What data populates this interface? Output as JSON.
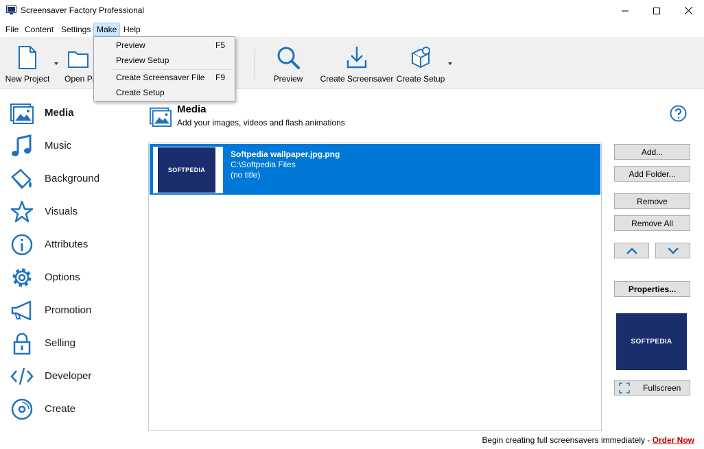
{
  "window": {
    "title": "Screensaver Factory Professional"
  },
  "menubar": {
    "items": [
      "File",
      "Content",
      "Settings",
      "Make",
      "Help"
    ]
  },
  "make_menu": {
    "items": [
      {
        "label": "Preview",
        "shortcut": "F5"
      },
      {
        "label": "Preview Setup",
        "shortcut": ""
      },
      {
        "label": "Create Screensaver File",
        "shortcut": "F9"
      },
      {
        "label": "Create Setup",
        "shortcut": ""
      }
    ]
  },
  "toolbar": {
    "new_project": "New Project",
    "open_project": "Open Pr",
    "preview": "Preview",
    "create_screensaver": "Create Screensaver",
    "create_setup": "Create Setup"
  },
  "sidebar": {
    "items": [
      {
        "label": "Media",
        "icon": "media-icon",
        "active": true
      },
      {
        "label": "Music",
        "icon": "music-icon"
      },
      {
        "label": "Background",
        "icon": "paint-bucket-icon"
      },
      {
        "label": "Visuals",
        "icon": "star-icon"
      },
      {
        "label": "Attributes",
        "icon": "info-icon"
      },
      {
        "label": "Options",
        "icon": "gear-icon"
      },
      {
        "label": "Promotion",
        "icon": "megaphone-icon"
      },
      {
        "label": "Selling",
        "icon": "lock-icon"
      },
      {
        "label": "Developer",
        "icon": "code-icon"
      },
      {
        "label": "Create",
        "icon": "disc-icon"
      }
    ]
  },
  "header": {
    "title": "Media",
    "subtitle": "Add your images, videos and flash animations"
  },
  "media_list": {
    "items": [
      {
        "name": "Softpedia wallpaper.jpg.png",
        "path": "C:\\Softpedia Files",
        "title": "(no title)",
        "thumb_text": "SOFTPEDIA"
      }
    ]
  },
  "buttons": {
    "add": "Add...",
    "add_folder": "Add Folder...",
    "remove": "Remove",
    "remove_all": "Remove All",
    "properties": "Properties...",
    "fullscreen": "Fullscreen"
  },
  "preview": {
    "text": "SOFTPEDIA"
  },
  "footer": {
    "text": "Begin creating full screensavers immediately - ",
    "link": "Order Now"
  },
  "colors": {
    "accent": "#0078d7",
    "icon_blue": "#1e73be",
    "thumb_bg": "#1a2e6e",
    "link": "#c00000"
  }
}
